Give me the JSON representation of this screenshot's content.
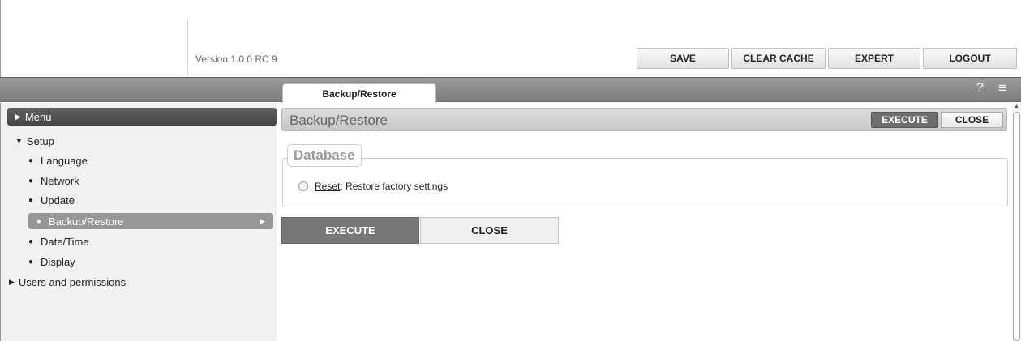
{
  "header": {
    "version": "Version 1.0.0 RC 9",
    "buttons": {
      "save": "SAVE",
      "clear_cache": "CLEAR CACHE",
      "expert": "EXPERT",
      "logout": "LOGOUT"
    }
  },
  "tabbar": {
    "active_tab": "Backup/Restore",
    "help_glyph": "?",
    "menu_glyph": "≡"
  },
  "sidebar": {
    "menu_label": "Menu",
    "setup_label": "Setup",
    "items": [
      "Language",
      "Network",
      "Update",
      "Backup/Restore",
      "Date/Time",
      "Display"
    ],
    "active_item": "Backup/Restore",
    "users_label": "Users and permissions"
  },
  "panel": {
    "title": "Backup/Restore",
    "execute_label": "EXECUTE",
    "close_label": "CLOSE",
    "section": {
      "legend": "Database",
      "option_link": "Reset",
      "option_text": ": Restore factory settings",
      "option_checked": false
    }
  },
  "icons": {
    "collapsed": "triangle-right-icon",
    "expanded": "triangle-down-icon",
    "bullet": "bullet-icon",
    "help": "help-icon",
    "hamburger": "hamburger-icon"
  },
  "colors": {
    "tabbar": "#8a8a8a",
    "active_item": "#979797",
    "execute": "#777777",
    "menu_bar": "#505050"
  }
}
